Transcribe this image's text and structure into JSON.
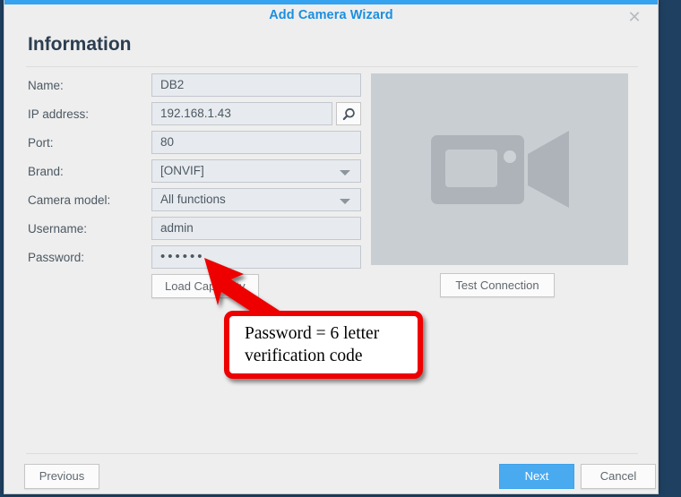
{
  "window": {
    "title": "Add Camera Wizard",
    "close_icon": "close-icon",
    "accent_color": "#35a3ef",
    "desktop_background": "#1f4061"
  },
  "page": {
    "heading": "Information"
  },
  "form": {
    "rows": [
      {
        "label": "Name:",
        "value": "DB2",
        "type": "text"
      },
      {
        "label": "IP address:",
        "value": "192.168.1.43",
        "type": "text"
      },
      {
        "label": "Port:",
        "value": "80",
        "type": "text"
      },
      {
        "label": "Brand:",
        "value": "[ONVIF]",
        "type": "select"
      },
      {
        "label": "Camera model:",
        "value": "All functions",
        "type": "select"
      },
      {
        "label": "Username:",
        "value": "admin",
        "type": "text"
      },
      {
        "label": "Password:",
        "value": "••••••",
        "type": "password",
        "dot_count": 6
      }
    ],
    "ip_search_icon": "search-icon",
    "load_capability_label": "Load Capability"
  },
  "preview": {
    "placeholder_icon": "camera-icon",
    "test_connection_label": "Test Connection"
  },
  "footer": {
    "previous_label": "Previous",
    "next_label": "Next",
    "cancel_label": "Cancel",
    "next_color": "#4aaaf0"
  },
  "annotation": {
    "line1": "Password = 6 letter",
    "line2": "verification code",
    "border_color": "#ee0000",
    "arrow_color": "#ee0000"
  }
}
